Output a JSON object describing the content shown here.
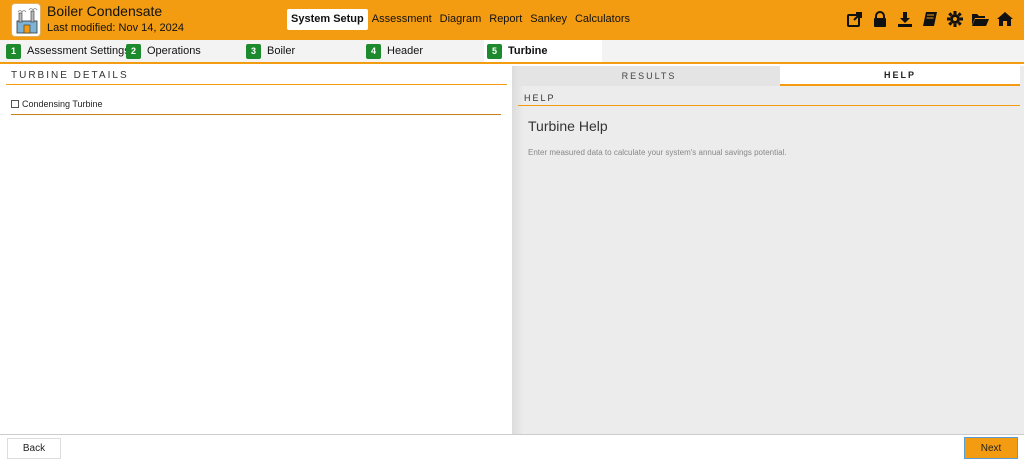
{
  "header": {
    "title": "Boiler Condensate",
    "modified": "Last modified: Nov 14, 2024",
    "nav": [
      {
        "label": "System Setup",
        "active": true
      },
      {
        "label": "Assessment",
        "active": false
      },
      {
        "label": "Diagram",
        "active": false
      },
      {
        "label": "Report",
        "active": false
      },
      {
        "label": "Sankey",
        "active": false
      },
      {
        "label": "Calculators",
        "active": false
      }
    ],
    "tools": [
      "export-icon",
      "lock-icon",
      "download-icon",
      "book-icon",
      "gear-icon",
      "folder-open-icon",
      "home-icon"
    ]
  },
  "steps": [
    {
      "num": "1",
      "label": "Assessment Settings"
    },
    {
      "num": "2",
      "label": "Operations"
    },
    {
      "num": "3",
      "label": "Boiler"
    },
    {
      "num": "4",
      "label": "Header"
    },
    {
      "num": "5",
      "label": "Turbine",
      "active": true
    }
  ],
  "left": {
    "section_title": "TURBINE DETAILS",
    "checkbox_label": "Condensing Turbine",
    "checkbox_checked": false
  },
  "right": {
    "tab_results": "RESULTS",
    "tab_help": "HELP",
    "help_section": "HELP",
    "help_title": "Turbine Help",
    "help_text": "Enter measured data to calculate your system's annual savings potential."
  },
  "footer": {
    "back": "Back",
    "next": "Next"
  },
  "colors": {
    "accent": "#f39c12",
    "step_badge": "#1e8a2e"
  }
}
